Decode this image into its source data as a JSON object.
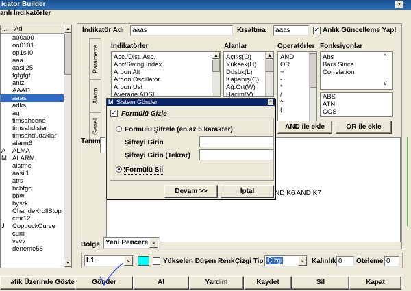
{
  "window": {
    "title": "icator Builder"
  },
  "left_panel": {
    "header": "anlı İndikatörler",
    "col_ad": "Ad",
    "items": [
      {
        "prefix": "",
        "name": "a00a00"
      },
      {
        "prefix": "",
        "name": "oo0101"
      },
      {
        "prefix": "",
        "name": "op1sil0"
      },
      {
        "prefix": "",
        "name": "aaa"
      },
      {
        "prefix": "",
        "name": "aasli25"
      },
      {
        "prefix": "",
        "name": "fgfgfgf"
      },
      {
        "prefix": "",
        "name": "aniz"
      },
      {
        "prefix": "",
        "name": "AAAD"
      },
      {
        "prefix": "",
        "name": "aaas"
      },
      {
        "prefix": "",
        "name": "adks"
      },
      {
        "prefix": "",
        "name": "ag"
      },
      {
        "prefix": "",
        "name": "timsahcene"
      },
      {
        "prefix": "",
        "name": "timsahdisler"
      },
      {
        "prefix": "",
        "name": "timsahdudaklar"
      },
      {
        "prefix": "",
        "name": "alarm6"
      },
      {
        "prefix": "A",
        "name": "ALMA"
      },
      {
        "prefix": "M",
        "name": "ALARM"
      },
      {
        "prefix": "",
        "name": "alstmc"
      },
      {
        "prefix": "",
        "name": "aasil1"
      },
      {
        "prefix": "",
        "name": "atrs"
      },
      {
        "prefix": "",
        "name": "bcbfgc"
      },
      {
        "prefix": "",
        "name": "bbw"
      },
      {
        "prefix": "",
        "name": "bysrk"
      },
      {
        "prefix": "",
        "name": "ChandeKrollStop"
      },
      {
        "prefix": "",
        "name": "cmr12"
      },
      {
        "prefix": "J",
        "name": "CoppockCurve"
      },
      {
        "prefix": "",
        "name": "cum"
      },
      {
        "prefix": "",
        "name": "vvvv"
      },
      {
        "prefix": "",
        "name": "deneme55"
      }
    ]
  },
  "form": {
    "name_label": "İndikatör Adı",
    "name_value": "aaas",
    "short_label": "Kısaltma",
    "short_value": "aaas",
    "live_update_label": "Anlık Güncelleme Yap!"
  },
  "tabs": [
    "Parametre",
    "Alarm",
    "Genel"
  ],
  "sections": {
    "indicators_header": "İndikatörler",
    "fields_header": "Alanlar",
    "operators_header": "Operatörler",
    "functions_header": "Fonksiyonlar"
  },
  "indicators": [
    "Acc./Dist. Asc.",
    "Acc/Swing Index",
    "Aroon Alt",
    "Aroon Oscillator",
    "Aroon Üst",
    "Average ADSI"
  ],
  "fields": [
    "Açılış(O)",
    "Yüksek(H)",
    "Düşük(L)",
    "Kapanış(C)",
    "Ağ.Ort(W)",
    "Hacim(V)"
  ],
  "operators": [
    "AND",
    "OR",
    "+",
    "-",
    "*",
    "/",
    "^",
    "("
  ],
  "functions": [
    "Abs",
    "Bars Since",
    "Correlation"
  ],
  "functions2": [
    "ABS",
    "ATN",
    "COS"
  ],
  "buttons": {
    "and_add": "AND ile ekle",
    "or_add": "OR ile ekle",
    "send_dialog": "Devam >>",
    "cancel_dialog": "İptal"
  },
  "definition": {
    "label": "Tanım",
    "text_fragment": "ND K6 AND K7"
  },
  "dialog": {
    "title": "Sistem Gönder",
    "hide_formula": "Formülü Gizle",
    "encrypt_formula": "Formülü Şifrele (en az 5 karakter)",
    "password": "Şifreyi Girin",
    "password_repeat": "Şifreyi Girin (Tekrar)",
    "delete_formula": "Formülü Sil"
  },
  "bottom": {
    "region_label": "Bölge",
    "region_value": "Yeni Pencere",
    "line_value": "L1",
    "color_hex": "#00ffff",
    "updown_label": "Yükselen Düşen Renk",
    "line_type_label": "Çizgi Tipi",
    "line_type_value": "Çizgi",
    "thickness_label": "Kalınlık",
    "thickness_value": "0",
    "offset_label": "Öteleme",
    "offset_value": "0"
  },
  "footer": {
    "show_on_chart": "afik Üzerinde Göster",
    "send": "Gönder",
    "get": "Al",
    "help": "Yardım",
    "save": "Kaydet",
    "delete": "Sil",
    "close": "Kapat"
  },
  "colors": {
    "title_bar": "#1a4f8f",
    "selection": "#316ac5",
    "dialog_title": "#0a246a"
  }
}
